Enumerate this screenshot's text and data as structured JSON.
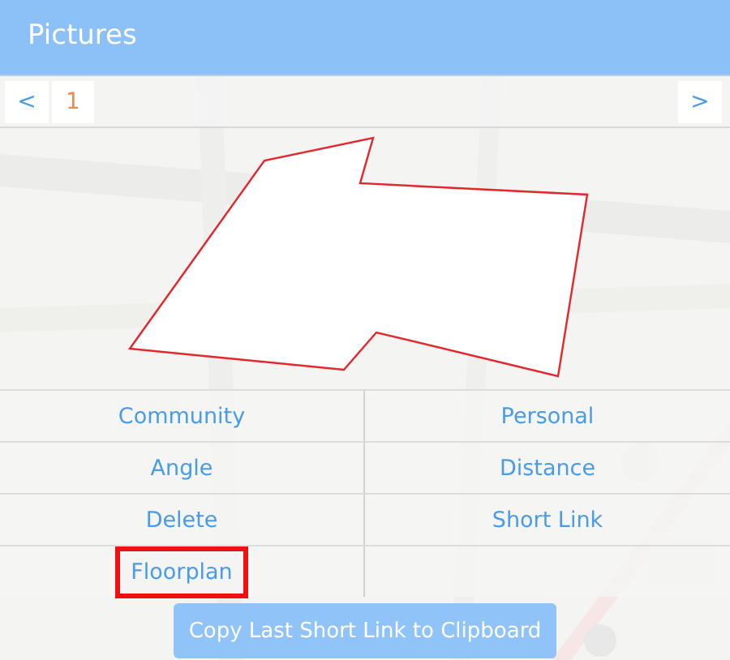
{
  "header": {
    "title": "Pictures"
  },
  "pager": {
    "prev": "<",
    "page": "1",
    "next": ">"
  },
  "actions": [
    {
      "label": "Community",
      "highlighted": false
    },
    {
      "label": "Personal",
      "highlighted": false
    },
    {
      "label": "Angle",
      "highlighted": false
    },
    {
      "label": "Distance",
      "highlighted": false
    },
    {
      "label": "Delete",
      "highlighted": false
    },
    {
      "label": "Short Link",
      "highlighted": false
    },
    {
      "label": "Floorplan",
      "highlighted": true
    }
  ],
  "copy_button": {
    "label": "Copy Last Short Link to Clipboard"
  }
}
